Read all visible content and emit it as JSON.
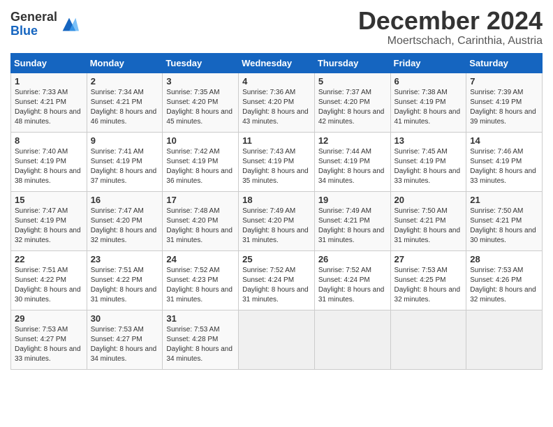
{
  "logo": {
    "general": "General",
    "blue": "Blue"
  },
  "title": "December 2024",
  "location": "Moertschach, Carinthia, Austria",
  "weekdays": [
    "Sunday",
    "Monday",
    "Tuesday",
    "Wednesday",
    "Thursday",
    "Friday",
    "Saturday"
  ],
  "weeks": [
    [
      {
        "day": "1",
        "sunrise": "7:33 AM",
        "sunset": "4:21 PM",
        "daylight": "8 hours and 48 minutes."
      },
      {
        "day": "2",
        "sunrise": "7:34 AM",
        "sunset": "4:21 PM",
        "daylight": "8 hours and 46 minutes."
      },
      {
        "day": "3",
        "sunrise": "7:35 AM",
        "sunset": "4:20 PM",
        "daylight": "8 hours and 45 minutes."
      },
      {
        "day": "4",
        "sunrise": "7:36 AM",
        "sunset": "4:20 PM",
        "daylight": "8 hours and 43 minutes."
      },
      {
        "day": "5",
        "sunrise": "7:37 AM",
        "sunset": "4:20 PM",
        "daylight": "8 hours and 42 minutes."
      },
      {
        "day": "6",
        "sunrise": "7:38 AM",
        "sunset": "4:19 PM",
        "daylight": "8 hours and 41 minutes."
      },
      {
        "day": "7",
        "sunrise": "7:39 AM",
        "sunset": "4:19 PM",
        "daylight": "8 hours and 39 minutes."
      }
    ],
    [
      {
        "day": "8",
        "sunrise": "7:40 AM",
        "sunset": "4:19 PM",
        "daylight": "8 hours and 38 minutes."
      },
      {
        "day": "9",
        "sunrise": "7:41 AM",
        "sunset": "4:19 PM",
        "daylight": "8 hours and 37 minutes."
      },
      {
        "day": "10",
        "sunrise": "7:42 AM",
        "sunset": "4:19 PM",
        "daylight": "8 hours and 36 minutes."
      },
      {
        "day": "11",
        "sunrise": "7:43 AM",
        "sunset": "4:19 PM",
        "daylight": "8 hours and 35 minutes."
      },
      {
        "day": "12",
        "sunrise": "7:44 AM",
        "sunset": "4:19 PM",
        "daylight": "8 hours and 34 minutes."
      },
      {
        "day": "13",
        "sunrise": "7:45 AM",
        "sunset": "4:19 PM",
        "daylight": "8 hours and 33 minutes."
      },
      {
        "day": "14",
        "sunrise": "7:46 AM",
        "sunset": "4:19 PM",
        "daylight": "8 hours and 33 minutes."
      }
    ],
    [
      {
        "day": "15",
        "sunrise": "7:47 AM",
        "sunset": "4:19 PM",
        "daylight": "8 hours and 32 minutes."
      },
      {
        "day": "16",
        "sunrise": "7:47 AM",
        "sunset": "4:20 PM",
        "daylight": "8 hours and 32 minutes."
      },
      {
        "day": "17",
        "sunrise": "7:48 AM",
        "sunset": "4:20 PM",
        "daylight": "8 hours and 31 minutes."
      },
      {
        "day": "18",
        "sunrise": "7:49 AM",
        "sunset": "4:20 PM",
        "daylight": "8 hours and 31 minutes."
      },
      {
        "day": "19",
        "sunrise": "7:49 AM",
        "sunset": "4:21 PM",
        "daylight": "8 hours and 31 minutes."
      },
      {
        "day": "20",
        "sunrise": "7:50 AM",
        "sunset": "4:21 PM",
        "daylight": "8 hours and 31 minutes."
      },
      {
        "day": "21",
        "sunrise": "7:50 AM",
        "sunset": "4:21 PM",
        "daylight": "8 hours and 30 minutes."
      }
    ],
    [
      {
        "day": "22",
        "sunrise": "7:51 AM",
        "sunset": "4:22 PM",
        "daylight": "8 hours and 30 minutes."
      },
      {
        "day": "23",
        "sunrise": "7:51 AM",
        "sunset": "4:22 PM",
        "daylight": "8 hours and 31 minutes."
      },
      {
        "day": "24",
        "sunrise": "7:52 AM",
        "sunset": "4:23 PM",
        "daylight": "8 hours and 31 minutes."
      },
      {
        "day": "25",
        "sunrise": "7:52 AM",
        "sunset": "4:24 PM",
        "daylight": "8 hours and 31 minutes."
      },
      {
        "day": "26",
        "sunrise": "7:52 AM",
        "sunset": "4:24 PM",
        "daylight": "8 hours and 31 minutes."
      },
      {
        "day": "27",
        "sunrise": "7:53 AM",
        "sunset": "4:25 PM",
        "daylight": "8 hours and 32 minutes."
      },
      {
        "day": "28",
        "sunrise": "7:53 AM",
        "sunset": "4:26 PM",
        "daylight": "8 hours and 32 minutes."
      }
    ],
    [
      {
        "day": "29",
        "sunrise": "7:53 AM",
        "sunset": "4:27 PM",
        "daylight": "8 hours and 33 minutes."
      },
      {
        "day": "30",
        "sunrise": "7:53 AM",
        "sunset": "4:27 PM",
        "daylight": "8 hours and 34 minutes."
      },
      {
        "day": "31",
        "sunrise": "7:53 AM",
        "sunset": "4:28 PM",
        "daylight": "8 hours and 34 minutes."
      },
      null,
      null,
      null,
      null
    ]
  ]
}
